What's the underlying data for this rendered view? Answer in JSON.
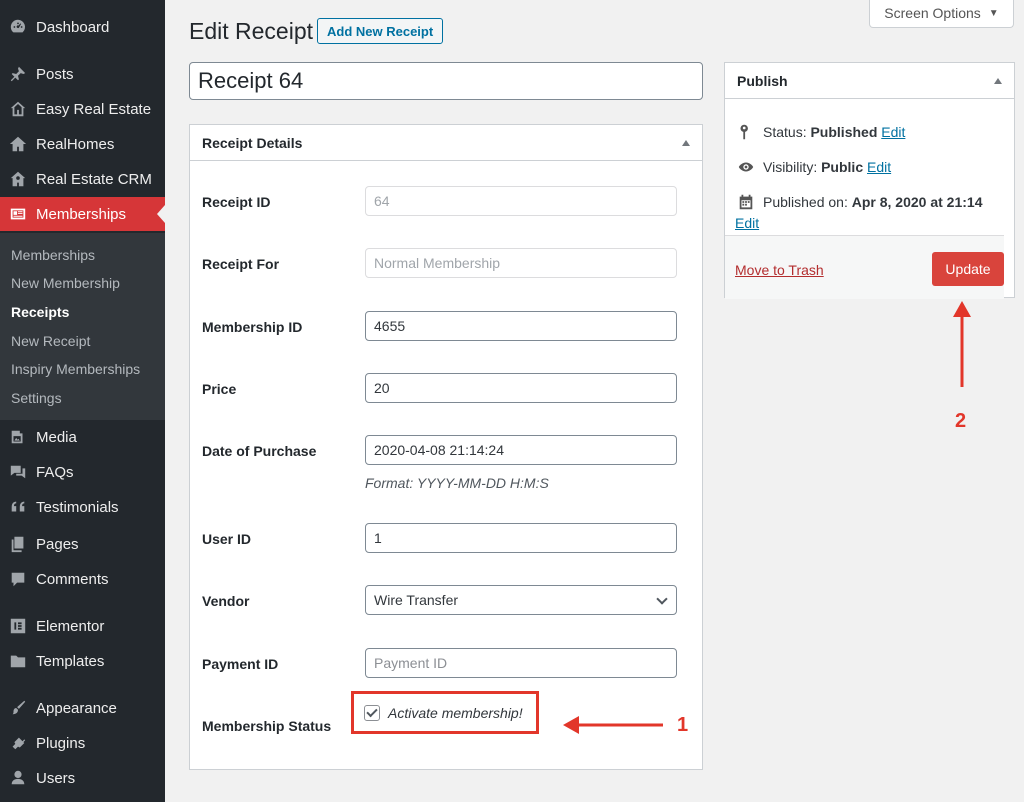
{
  "sidebar": {
    "items": [
      {
        "label": "Dashboard",
        "icon": "dashboard-icon"
      },
      {
        "label": "Posts",
        "icon": "pin-icon"
      },
      {
        "label": "Easy Real Estate",
        "icon": "house-outline-icon"
      },
      {
        "label": "RealHomes",
        "icon": "house-icon"
      },
      {
        "label": "Real Estate CRM",
        "icon": "crm-icon"
      },
      {
        "label": "Memberships",
        "icon": "id-card-icon"
      },
      {
        "label": "Media",
        "icon": "media-icon"
      },
      {
        "label": "FAQs",
        "icon": "chat-icon"
      },
      {
        "label": "Testimonials",
        "icon": "quote-icon"
      },
      {
        "label": "Pages",
        "icon": "pages-icon"
      },
      {
        "label": "Comments",
        "icon": "comment-icon"
      },
      {
        "label": "Elementor",
        "icon": "elementor-icon"
      },
      {
        "label": "Templates",
        "icon": "folder-icon"
      },
      {
        "label": "Appearance",
        "icon": "brush-icon"
      },
      {
        "label": "Plugins",
        "icon": "plug-icon"
      },
      {
        "label": "Users",
        "icon": "user-icon"
      }
    ],
    "submenu": [
      "Memberships",
      "New Membership",
      "Receipts",
      "New Receipt",
      "Inspiry Memberships",
      "Settings"
    ]
  },
  "header": {
    "title": "Edit Receipt",
    "add_new": "Add New Receipt",
    "screen_options": "Screen Options",
    "post_title": "Receipt 64"
  },
  "details": {
    "heading": "Receipt Details",
    "receipt_id_label": "Receipt ID",
    "receipt_id_value": "64",
    "receipt_for_label": "Receipt For",
    "receipt_for_placeholder": "Normal Membership",
    "membership_id_label": "Membership ID",
    "membership_id_value": "4655",
    "price_label": "Price",
    "price_value": "20",
    "date_label": "Date of Purchase",
    "date_value": "2020-04-08 21:14:24",
    "date_hint": "Format: YYYY-MM-DD H:M:S",
    "user_id_label": "User ID",
    "user_id_value": "1",
    "vendor_label": "Vendor",
    "vendor_value": "Wire Transfer",
    "payment_id_label": "Payment ID",
    "payment_id_placeholder": "Payment ID",
    "status_label": "Membership Status",
    "status_checkbox": "Activate membership!"
  },
  "publish": {
    "heading": "Publish",
    "status_prefix": "Status: ",
    "status_value": "Published",
    "visibility_prefix": "Visibility: ",
    "visibility_value": "Public",
    "published_prefix": "Published on: ",
    "published_value": "Apr 8, 2020 at 21:14",
    "edit": "Edit",
    "trash": "Move to Trash",
    "update": "Update"
  },
  "annotations": {
    "one": "1",
    "two": "2"
  },
  "colors": {
    "accent": "#d63638",
    "annotation": "#e2362a",
    "link": "#0071a1",
    "sidebar": "#23282d"
  }
}
